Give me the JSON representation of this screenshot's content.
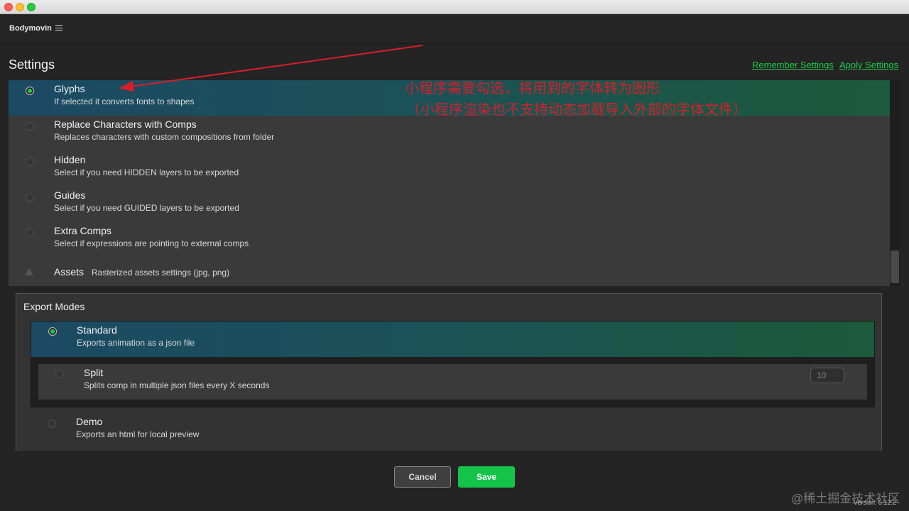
{
  "app": {
    "name": "Bodymovin"
  },
  "header": {
    "title": "Settings",
    "remember_label": "Remember Settings",
    "apply_label": "Apply Settings"
  },
  "options": [
    {
      "title": "Glyphs",
      "desc": "If selected it converts fonts to shapes",
      "selected": true
    },
    {
      "title": "Replace Characters with Comps",
      "desc": "Replaces characters with custom compositions from folder",
      "selected": false
    },
    {
      "title": "Hidden",
      "desc": "Select if you need HIDDEN layers to be exported",
      "selected": false
    },
    {
      "title": "Guides",
      "desc": "Select if you need GUIDED layers to be exported",
      "selected": false
    },
    {
      "title": "Extra Comps",
      "desc": "Select if expressions are pointing to external comps",
      "selected": false
    }
  ],
  "assets": {
    "title": "Assets",
    "desc": "Rasterized assets settings (jpg, png)"
  },
  "export": {
    "title": "Export Modes",
    "modes": [
      {
        "title": "Standard",
        "desc": "Exports animation as a json file",
        "selected": true
      },
      {
        "title": "Split",
        "desc": "Splits comp in multiple json files every X seconds",
        "selected": false,
        "value": "10"
      },
      {
        "title": "Demo",
        "desc": "Exports an html for local preview",
        "selected": false
      }
    ]
  },
  "footer": {
    "cancel_label": "Cancel",
    "save_label": "Save",
    "version": "Version: 5.12.2"
  },
  "annotation": {
    "line1": "小程序需要勾选，将用到的字体转为图形",
    "line2": "（小程序渲染也不支持动态加载导入外部的字体文件）",
    "color": "#d81e2a"
  },
  "watermark": "@稀土掘金技术社区",
  "colors": {
    "accent": "#1dc94a",
    "save": "#13c448"
  }
}
